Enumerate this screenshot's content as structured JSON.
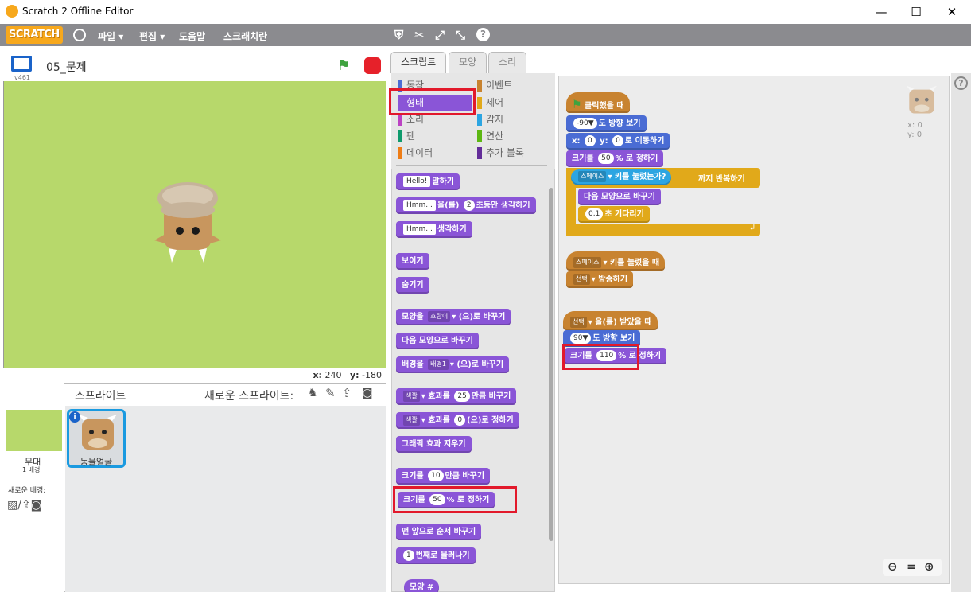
{
  "window": {
    "title": "Scratch 2 Offline Editor",
    "minimize": "—",
    "maximize": "☐",
    "close": "✕"
  },
  "menu": {
    "logo": "SCRATCH",
    "file": "파일",
    "edit": "편집",
    "help": "도움말",
    "scratcher": "스크래치란",
    "globe_icon": "globe-icon"
  },
  "stage": {
    "project_name": "05_문제",
    "version": "v461",
    "coords_x_label": "x:",
    "coords_x": "240",
    "coords_y_label": "y:",
    "coords_y": "-180",
    "bg_color": "#b7d86b"
  },
  "sprites": {
    "header": "스프라이트",
    "new_sprite": "새로운 스프라이트:",
    "stage_label": "무대",
    "stage_count": "1 배경",
    "new_backdrop": "새로운 배경:",
    "sprite_name": "동물얼굴"
  },
  "tabs": [
    "스크립트",
    "모양",
    "소리"
  ],
  "categories": [
    {
      "label": "동작",
      "color": "#4a6cd4"
    },
    {
      "label": "이벤트",
      "color": "#c88330"
    },
    {
      "label": "형태",
      "color": "#8a55d7"
    },
    {
      "label": "제어",
      "color": "#e1a91a"
    },
    {
      "label": "소리",
      "color": "#bb42c3"
    },
    {
      "label": "감지",
      "color": "#2ca5e2"
    },
    {
      "label": "펜",
      "color": "#0e9a6c"
    },
    {
      "label": "연산",
      "color": "#5cb712"
    },
    {
      "label": "데이터",
      "color": "#ee7d16"
    },
    {
      "label": "추가 블록",
      "color": "#632d99"
    }
  ],
  "palette": {
    "say_default": "Hello!",
    "say_text": "말하기",
    "think_secs_default": "Hmm...",
    "think_secs_text1": "을(를)",
    "think_secs_num": "2",
    "think_secs_text2": "초동안 생각하기",
    "think_default": "Hmm...",
    "think_text": "생각하기",
    "show": "보이기",
    "hide": "숨기기",
    "switch_costume_text1": "모양을",
    "switch_costume_dd": "호랑이",
    "switch_costume_text2": "(으)로 바꾸기",
    "next_costume": "다음 모양으로 바꾸기",
    "switch_backdrop_text1": "배경을",
    "switch_backdrop_dd": "배경1",
    "switch_backdrop_text2": "(으)로 바꾸기",
    "change_effect_dd": "색깔",
    "change_effect_text1": "효과를",
    "change_effect_num": "25",
    "change_effect_text2": "만큼 바꾸기",
    "set_effect_dd": "색깔",
    "set_effect_text1": "효과를",
    "set_effect_num": "0",
    "set_effect_text2": "(으)로 정하기",
    "clear_effects": "그래픽 효과 지우기",
    "change_size_text1": "크기를",
    "change_size_num": "10",
    "change_size_text2": "만큼 바꾸기",
    "set_size_text1": "크기를",
    "set_size_num": "50",
    "set_size_text2": "% 로 정하기",
    "go_front": "맨 앞으로 순서 바꾸기",
    "go_back_num": "1",
    "go_back_text": "번째로 물러나기",
    "costume_num": "모양 #"
  },
  "scripts": {
    "s1_hat": "클릭했을 때",
    "s1_dir_num": "-90▼",
    "s1_dir_text": "도 방향 보기",
    "s1_goto_x_label": "x:",
    "s1_goto_x": "0",
    "s1_goto_y_label": "y:",
    "s1_goto_y": "0",
    "s1_goto_text": "로 이동하기",
    "s1_size_text1": "크기를",
    "s1_size_num": "50",
    "s1_size_text2": "% 로 정하기",
    "s1_repeat_dd": "스페이스",
    "s1_repeat_sense": "키를 눌렀는가?",
    "s1_repeat_text": "까지 반복하기",
    "s1_next": "다음 모양으로 바꾸기",
    "s1_wait_num": "0.1",
    "s1_wait_text": "초 기다리기",
    "s2_key_dd": "스페이스",
    "s2_key_text": "키를 눌렀을 때",
    "s2_broadcast_dd": "선택",
    "s2_broadcast_text": "방송하기",
    "s3_recv_dd": "선택",
    "s3_recv_text": "을(를) 받았을 때",
    "s3_dir_num": "90▼",
    "s3_dir_text": "도 방향 보기",
    "s3_size_text1": "크기를",
    "s3_size_num": "110",
    "s3_size_text2": "% 로 정하기",
    "sprite_x": "x: 0",
    "sprite_y": "y: 0"
  }
}
